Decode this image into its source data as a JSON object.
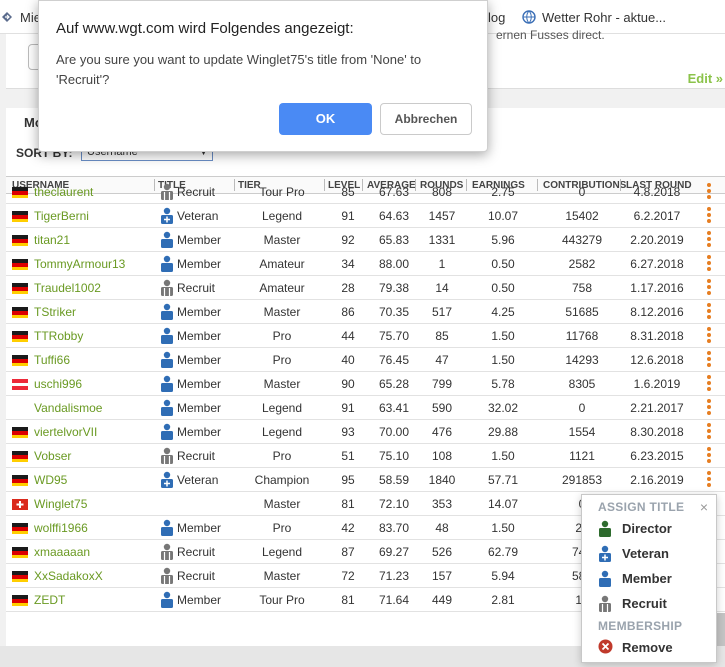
{
  "bookmarks": [
    {
      "label": "Mie",
      "icon": "arrow-bookmark-icon"
    },
    {
      "label": "log",
      "icon": ""
    },
    {
      "label": "Wetter Rohr - aktue...",
      "icon": "weather-globe-icon"
    }
  ],
  "top_panel": {
    "page_button": "1",
    "edit_link": "Edit »",
    "cut_text": "ernen Fusses direct."
  },
  "tab": "Mo",
  "sort": {
    "label": "SORT BY:",
    "value": "Username"
  },
  "columns": [
    "USERNAME",
    "TITLE",
    "TIER",
    "LEVEL",
    "AVERAGE",
    "ROUNDS",
    "EARNINGS",
    "CONTRIBUTIONS",
    "LAST ROUND"
  ],
  "rows": [
    {
      "flag": "de",
      "username": "theclaurent",
      "title_icon": "recruit",
      "title": "Recruit",
      "tier": "Tour Pro",
      "level": "85",
      "average": "67.63",
      "rounds": "808",
      "earnings": "2.75",
      "contributions": "0",
      "last_round": "4.8.2018"
    },
    {
      "flag": "de",
      "username": "TigerBerni",
      "title_icon": "veteran",
      "title": "Veteran",
      "tier": "Legend",
      "level": "91",
      "average": "64.63",
      "rounds": "1457",
      "earnings": "10.07",
      "contributions": "15402",
      "last_round": "6.2.2017"
    },
    {
      "flag": "de",
      "username": "titan21",
      "title_icon": "member",
      "title": "Member",
      "tier": "Master",
      "level": "92",
      "average": "65.83",
      "rounds": "1331",
      "earnings": "5.96",
      "contributions": "443279",
      "last_round": "2.20.2019"
    },
    {
      "flag": "de",
      "username": "TommyArmour13",
      "title_icon": "member",
      "title": "Member",
      "tier": "Amateur",
      "level": "34",
      "average": "88.00",
      "rounds": "1",
      "earnings": "0.50",
      "contributions": "2582",
      "last_round": "6.27.2018"
    },
    {
      "flag": "de",
      "username": "Traudel1002",
      "title_icon": "recruit",
      "title": "Recruit",
      "tier": "Amateur",
      "level": "28",
      "average": "79.38",
      "rounds": "14",
      "earnings": "0.50",
      "contributions": "758",
      "last_round": "1.17.2016"
    },
    {
      "flag": "de",
      "username": "TStriker",
      "title_icon": "member",
      "title": "Member",
      "tier": "Master",
      "level": "86",
      "average": "70.35",
      "rounds": "517",
      "earnings": "4.25",
      "contributions": "51685",
      "last_round": "8.12.2016"
    },
    {
      "flag": "de",
      "username": "TTRobby",
      "title_icon": "member",
      "title": "Member",
      "tier": "Pro",
      "level": "44",
      "average": "75.70",
      "rounds": "85",
      "earnings": "1.50",
      "contributions": "11768",
      "last_round": "8.31.2018"
    },
    {
      "flag": "de",
      "username": "Tuffi66",
      "title_icon": "member",
      "title": "Member",
      "tier": "Pro",
      "level": "40",
      "average": "76.45",
      "rounds": "47",
      "earnings": "1.50",
      "contributions": "14293",
      "last_round": "12.6.2018"
    },
    {
      "flag": "at",
      "username": "uschi996",
      "title_icon": "member",
      "title": "Member",
      "tier": "Master",
      "level": "90",
      "average": "65.28",
      "rounds": "799",
      "earnings": "5.78",
      "contributions": "8305",
      "last_round": "1.6.2019"
    },
    {
      "flag": "",
      "username": "Vandalismoe",
      "title_icon": "member",
      "title": "Member",
      "tier": "Legend",
      "level": "91",
      "average": "63.41",
      "rounds": "590",
      "earnings": "32.02",
      "contributions": "0",
      "last_round": "2.21.2017"
    },
    {
      "flag": "de",
      "username": "viertelvorVII",
      "title_icon": "member",
      "title": "Member",
      "tier": "Legend",
      "level": "93",
      "average": "70.00",
      "rounds": "476",
      "earnings": "29.88",
      "contributions": "1554",
      "last_round": "8.30.2018"
    },
    {
      "flag": "de",
      "username": "Vobser",
      "title_icon": "recruit",
      "title": "Recruit",
      "tier": "Pro",
      "level": "51",
      "average": "75.10",
      "rounds": "108",
      "earnings": "1.50",
      "contributions": "1121",
      "last_round": "6.23.2015"
    },
    {
      "flag": "de",
      "username": "WD95",
      "title_icon": "veteran",
      "title": "Veteran",
      "tier": "Champion",
      "level": "95",
      "average": "58.59",
      "rounds": "1840",
      "earnings": "57.71",
      "contributions": "291853",
      "last_round": "2.16.2019"
    },
    {
      "flag": "ch",
      "username": "Winglet75",
      "title_icon": "",
      "title": "",
      "tier": "Master",
      "level": "81",
      "average": "72.10",
      "rounds": "353",
      "earnings": "14.07",
      "contributions": "0",
      "last_round": ""
    },
    {
      "flag": "de",
      "username": "wolffi1966",
      "title_icon": "member",
      "title": "Member",
      "tier": "Pro",
      "level": "42",
      "average": "83.70",
      "rounds": "48",
      "earnings": "1.50",
      "contributions": "29",
      "last_round": ""
    },
    {
      "flag": "de",
      "username": "xmaaaaan",
      "title_icon": "recruit",
      "title": "Recruit",
      "tier": "Legend",
      "level": "87",
      "average": "69.27",
      "rounds": "526",
      "earnings": "62.79",
      "contributions": "747",
      "last_round": ""
    },
    {
      "flag": "de",
      "username": "XxSadakoxX",
      "title_icon": "recruit",
      "title": "Recruit",
      "tier": "Master",
      "level": "72",
      "average": "71.23",
      "rounds": "157",
      "earnings": "5.94",
      "contributions": "585",
      "last_round": ""
    },
    {
      "flag": "de",
      "username": "ZEDT",
      "title_icon": "member",
      "title": "Member",
      "tier": "Tour Pro",
      "level": "81",
      "average": "71.64",
      "rounds": "449",
      "earnings": "2.81",
      "contributions": "14",
      "last_round": ""
    }
  ],
  "dialog": {
    "title": "Auf www.wgt.com wird Folgendes angezeigt:",
    "message": "Are you sure you want to update Winglet75's title from 'None' to 'Recruit'?",
    "ok": "OK",
    "cancel": "Abbrechen"
  },
  "popover": {
    "assign_header": "ASSIGN TITLE",
    "close": "×",
    "options": [
      {
        "icon": "director",
        "label": "Director"
      },
      {
        "icon": "veteran",
        "label": "Veteran"
      },
      {
        "icon": "member",
        "label": "Member"
      },
      {
        "icon": "recruit",
        "label": "Recruit"
      }
    ],
    "membership_header": "MEMBERSHIP",
    "remove": "Remove"
  },
  "colors": {
    "username_green": "#6a9a23",
    "kebab_orange": "#e67e22",
    "member_blue": "#2f6db5",
    "director_green": "#2e6b2e",
    "recruit_gray": "#777777",
    "ok_blue": "#4a8af4",
    "remove_red": "#c0392b"
  }
}
